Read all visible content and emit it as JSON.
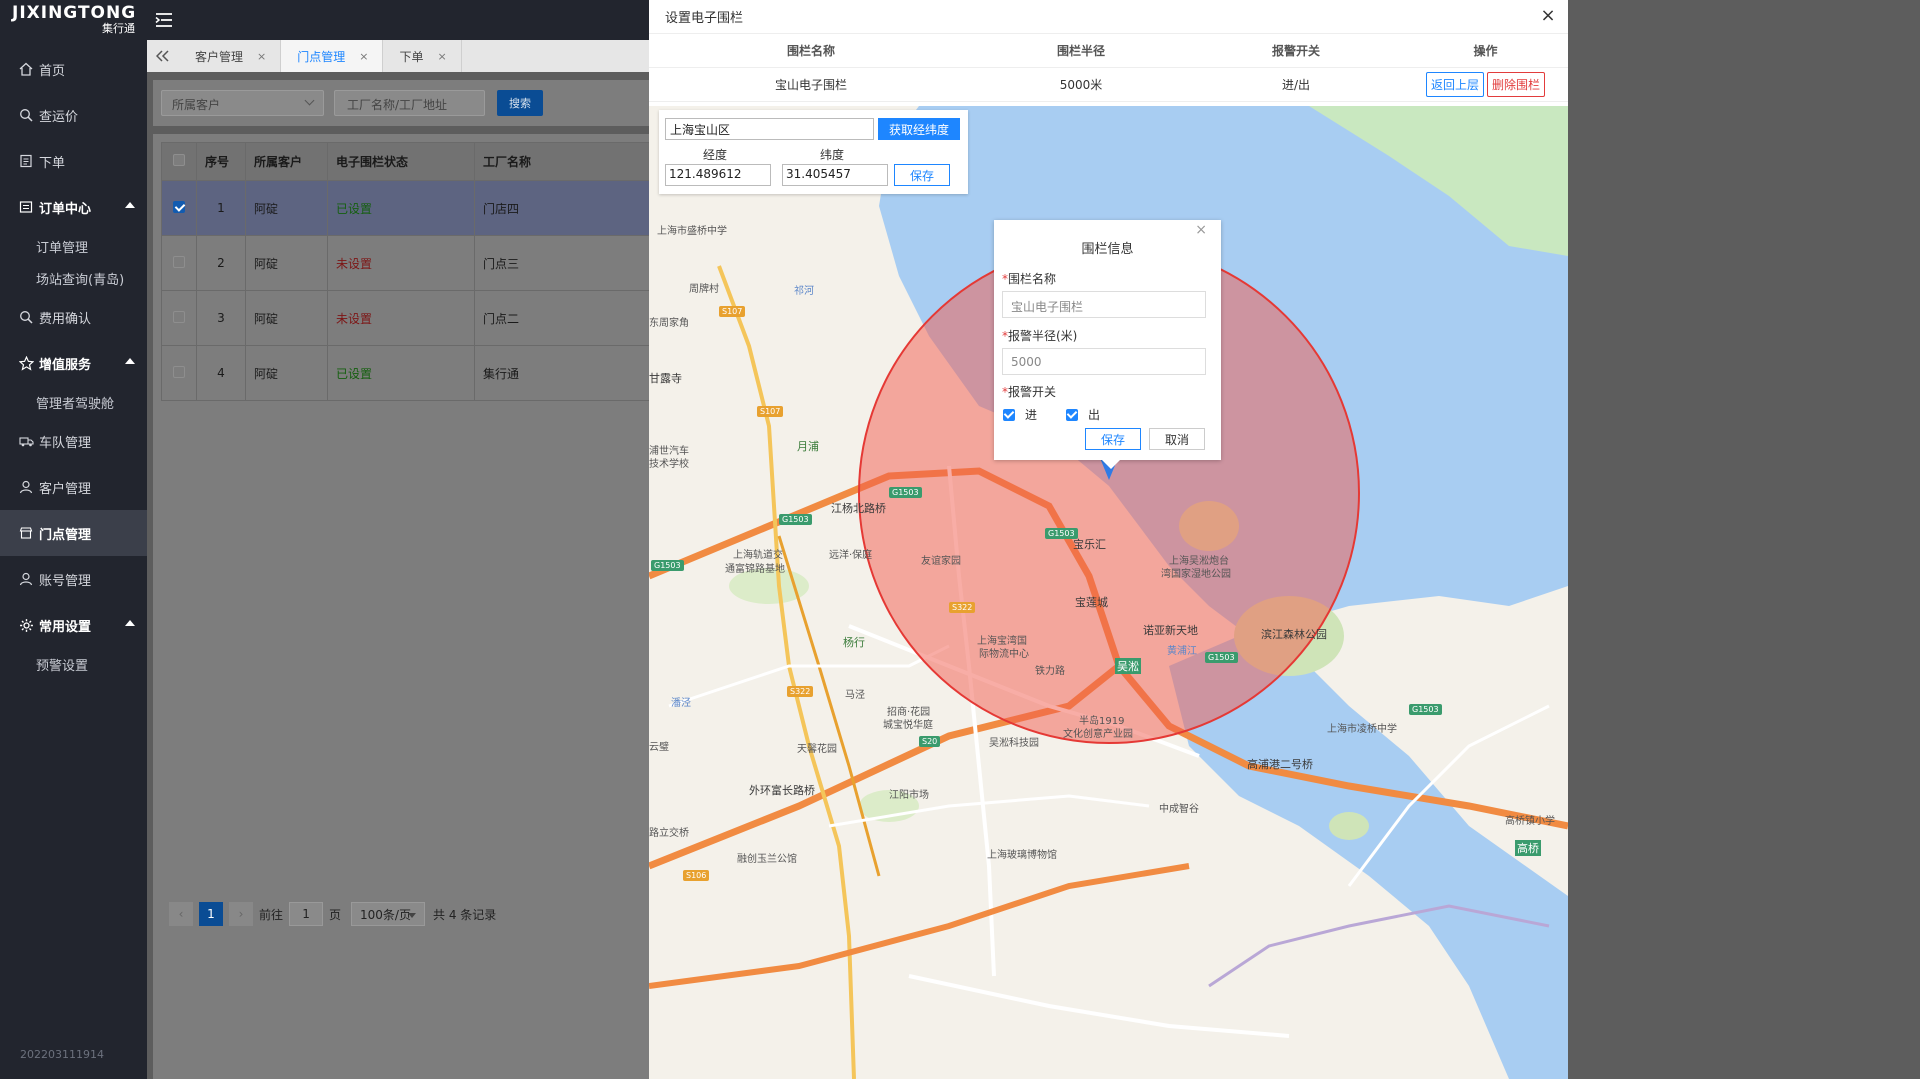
{
  "app": {
    "logo": "JIXINGTONG",
    "logo_sub": "集行通",
    "version": "202203111914"
  },
  "sidebar": {
    "items": [
      {
        "label": "首页",
        "icon": "home-icon"
      },
      {
        "label": "查运价",
        "icon": "search-icon"
      },
      {
        "label": "下单",
        "icon": "document-icon"
      },
      {
        "label": "订单中心",
        "icon": "order-icon"
      },
      {
        "label": "订单管理"
      },
      {
        "label": "场站查询(青岛)"
      },
      {
        "label": "费用确认",
        "icon": "search-icon"
      },
      {
        "label": "增值服务",
        "icon": "star-icon"
      },
      {
        "label": "管理者驾驶舱"
      },
      {
        "label": "车队管理",
        "icon": "truck-icon"
      },
      {
        "label": "客户管理",
        "icon": "user-icon"
      },
      {
        "label": "门点管理",
        "icon": "store-icon"
      },
      {
        "label": "账号管理",
        "icon": "user-icon"
      },
      {
        "label": "常用设置",
        "icon": "gear-icon"
      },
      {
        "label": "预警设置"
      }
    ]
  },
  "tabs": [
    {
      "label": "客户管理",
      "close": "×"
    },
    {
      "label": "门点管理",
      "close": "×"
    },
    {
      "label": "下单",
      "close": "×"
    }
  ],
  "filters": {
    "customer_placeholder": "所属客户",
    "factory_placeholder": "工厂名称/工厂地址",
    "search_label": "搜索"
  },
  "table": {
    "columns": [
      "序号",
      "所属客户",
      "电子围栏状态",
      "工厂名称"
    ],
    "rows": [
      {
        "no": "1",
        "customer": "阿碇",
        "status": "已设置",
        "factory": "门店四",
        "selected": true
      },
      {
        "no": "2",
        "customer": "阿碇",
        "status": "未设置",
        "factory": "门点三",
        "selected": false
      },
      {
        "no": "3",
        "customer": "阿碇",
        "status": "未设置",
        "factory": "门点二",
        "selected": false
      },
      {
        "no": "4",
        "customer": "阿碇",
        "status": "已设置",
        "factory": "集行通",
        "selected": false
      }
    ]
  },
  "pager": {
    "current": "1",
    "goto_label": "前往",
    "goto_value": "1",
    "page_unit": "页",
    "page_size": "100条/页",
    "total": "共 4 条记录"
  },
  "dialog": {
    "title": "设置电子围栏",
    "close": "×",
    "columns": [
      "围栏名称",
      "围栏半径",
      "报警开关",
      "操作"
    ],
    "row": {
      "name": "宝山电子围栏",
      "radius": "5000米",
      "alarm": "进/出"
    },
    "back_label": "返回上层",
    "delete_label": "删除围栏"
  },
  "geo": {
    "address": "上海宝山区",
    "get_coords_label": "获取经纬度",
    "lng_label": "经度",
    "lat_label": "纬度",
    "lng": "121.489612",
    "lat": "31.405457",
    "save_label": "保存"
  },
  "fence_info": {
    "title": "围栏信息",
    "close": "×",
    "name_label": "围栏名称",
    "name_value": "宝山电子围栏",
    "radius_label": "报警半径(米)",
    "radius_value": "5000",
    "switch_label": "报警开关",
    "in_label": "进",
    "out_label": "出",
    "required": "*",
    "save_label": "保存",
    "cancel_label": "取消"
  },
  "map": {
    "labels": [
      "上海市盛桥中学",
      "周牌村",
      "东周家角",
      "甘露寺",
      "祁河",
      "月浦",
      "浦世汽车",
      "技术学校",
      "江杨北路桥",
      "上海轨道交",
      "通富锦路基地",
      "远洋·保庭",
      "友谊家园",
      "宝乐汇",
      "宝莲城",
      "上海吴淞炮台",
      "湾国家湿地公园",
      "滨江森林公园",
      "诺亚新天地",
      "上海宝湾国",
      "际物流中心",
      "杨行",
      "招商·花园",
      "城宝悦华庭",
      "天馨花园",
      "吴淞科技园",
      "半岛1919",
      "文化创意产业园",
      "外环富长路桥",
      "江阳市场",
      "上海市凌桥中学",
      "高浦港二号桥",
      "中成智谷",
      "高桥镇小学",
      "上海玻璃博物馆",
      "融创玉兰公馆",
      "路立交桥",
      "吴淞",
      "高桥",
      "潘泾",
      "马泾",
      "铁力路",
      "云璧",
      "黄浦江"
    ],
    "roads": [
      "G1503",
      "G1503",
      "G1503",
      "G1503",
      "G1503",
      "G1503",
      "S107",
      "S107",
      "S322",
      "S322",
      "S20",
      "S106"
    ],
    "fence_color": "#e53935"
  }
}
